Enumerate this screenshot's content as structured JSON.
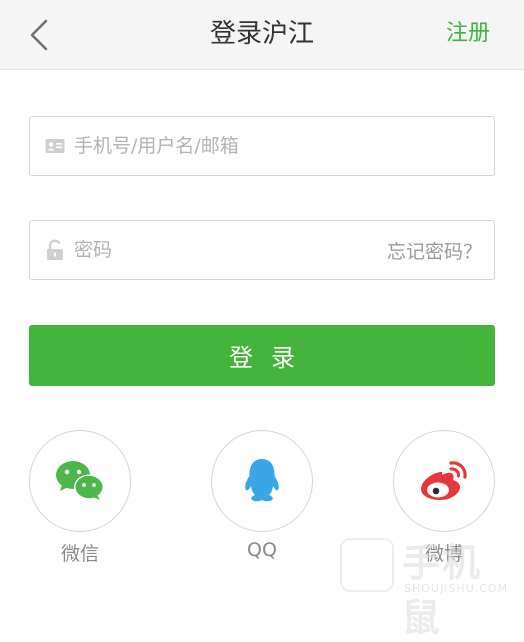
{
  "header": {
    "title": "登录沪江",
    "register_label": "注册",
    "back_icon": "chevron-left-icon"
  },
  "form": {
    "username_placeholder": "手机号/用户名/邮箱",
    "username_icon": "id-card-icon",
    "password_placeholder": "密码",
    "password_icon": "lock-icon",
    "forgot_label": "忘记密码？",
    "login_label": "登录"
  },
  "social": [
    {
      "label": "微信",
      "icon": "wechat-icon",
      "color": "#4cb849"
    },
    {
      "label": "QQ",
      "icon": "qq-icon",
      "color": "#39a6e8"
    },
    {
      "label": "微博",
      "icon": "weibo-icon",
      "color": "#e6373b"
    }
  ],
  "watermark": {
    "text": "手机鼠",
    "subtext": "SHOUJISHU.COM"
  },
  "colors": {
    "accent": "#45b43a",
    "register": "#3fb43f"
  }
}
